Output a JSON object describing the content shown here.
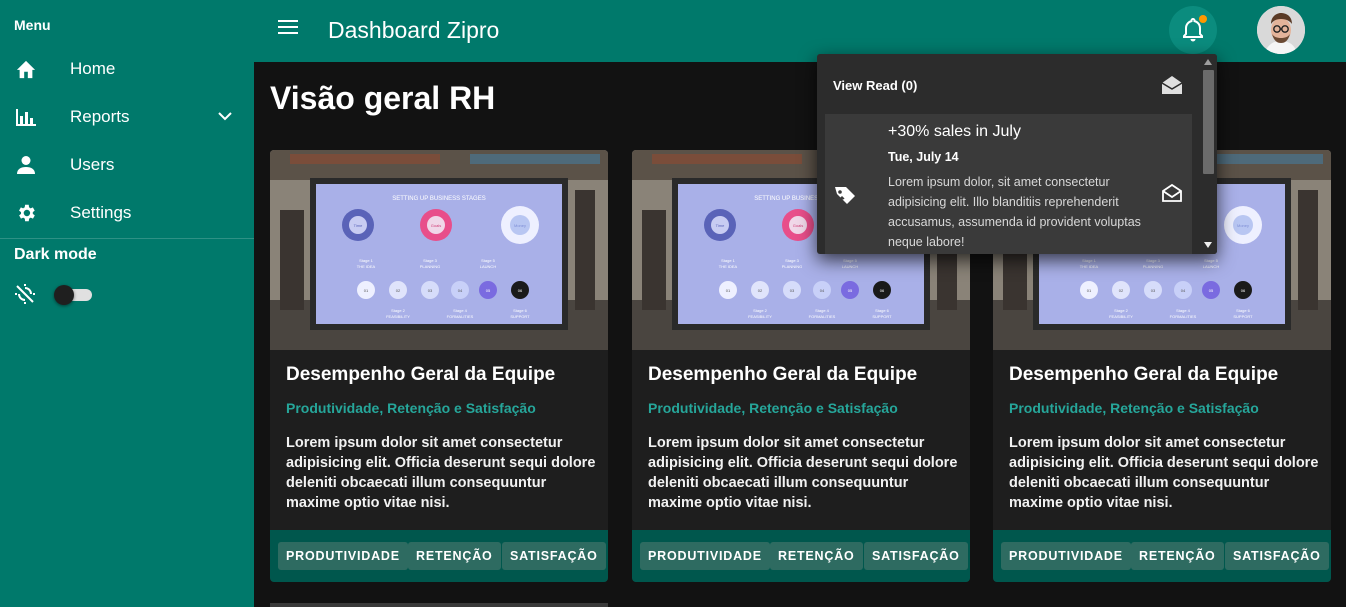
{
  "sidebar": {
    "menu_title": "Menu",
    "items": [
      {
        "label": "Home",
        "icon": "home-icon"
      },
      {
        "label": "Reports",
        "icon": "bar-chart-icon",
        "expandable": true
      },
      {
        "label": "Users",
        "icon": "person-icon"
      },
      {
        "label": "Settings",
        "icon": "gear-icon"
      }
    ],
    "dark_mode_label": "Dark mode",
    "dark_mode_on": false
  },
  "header": {
    "title": "Dashboard Zipro",
    "menu_icon": "hamburger-icon",
    "notification_icon": "bell-icon",
    "has_unread": true
  },
  "main": {
    "page_title": "Visão geral RH",
    "cards": [
      {
        "title": "Desempenho Geral da Equipe",
        "subtitle": "Produtividade, Retenção e Satisfação",
        "text": "Lorem ipsum dolor sit amet consectetur adipisicing elit. Officia deserunt sequi dolore deleniti obcaecati illum consequuntur maxime optio vitae nisi.",
        "tags": [
          "PRODUTIVIDADE",
          "RETENÇÃO",
          "SATISFAÇÃO"
        ]
      },
      {
        "title": "Desempenho Geral da Equipe",
        "subtitle": "Produtividade, Retenção e Satisfação",
        "text": "Lorem ipsum dolor sit amet consectetur adipisicing elit. Officia deserunt sequi dolore deleniti obcaecati illum consequuntur maxime optio vitae nisi.",
        "tags": [
          "PRODUTIVIDADE",
          "RETENÇÃO",
          "SATISFAÇÃO"
        ]
      },
      {
        "title": "Desempenho Geral da Equipe",
        "subtitle": "Produtividade, Retenção e Satisfação",
        "text": "Lorem ipsum dolor sit amet consectetur adipisicing elit. Officia deserunt sequi dolore deleniti obcaecati illum consequuntur maxime optio vitae nisi.",
        "tags": [
          "PRODUTIVIDADE",
          "RETENÇÃO",
          "SATISFAÇÃO"
        ]
      }
    ],
    "card_image_text": {
      "heading": "SETTING UP BUSINESS STAGES",
      "donut_labels": [
        "Time",
        "Goals",
        "Money"
      ],
      "steps": [
        "01",
        "02",
        "03",
        "04",
        "05",
        "06"
      ],
      "upper_stages": [
        "Stage 1",
        "THE IDEA",
        "Stage 3",
        "PLANNING",
        "Stage 5",
        "LAUNCH"
      ],
      "lower_stages": [
        "Stage 2",
        "FEASIBILITY",
        "Stage 4",
        "FORMALITIES",
        "Stage 6",
        "SUPPORT"
      ]
    }
  },
  "notifications": {
    "header": "View Read (0)",
    "items": [
      {
        "title": "+30% sales in July",
        "date": "Tue, July 14",
        "body": "Lorem ipsum dolor, sit amet consectetur adipisicing elit. Illo blanditiis reprehenderit accusamus, assumenda id provident voluptas neque labore!"
      }
    ]
  },
  "colors": {
    "primary": "#00796b",
    "accent": "#26a69a",
    "background": "#121212",
    "card": "#1e1e1e",
    "badge": "#ff9800"
  }
}
